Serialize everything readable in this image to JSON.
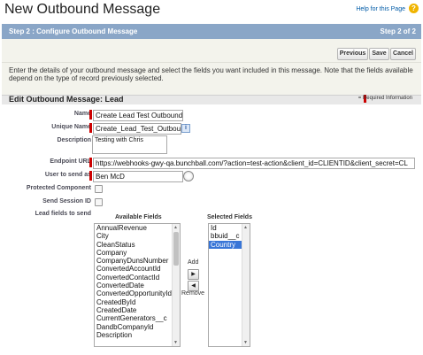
{
  "page_title": "New Outbound Message",
  "help_link": "Help for this Page",
  "help_icon": "?",
  "step": {
    "title": "Step 2 : Configure Outbound Message",
    "count": "Step 2 of 2"
  },
  "buttons": {
    "previous": "Previous",
    "save": "Save",
    "cancel": "Cancel"
  },
  "description": "Enter the details of your outbound message and select the fields you want included in this message. Note that the fields available depend on the type of record previously selected.",
  "section": {
    "title": "Edit Outbound Message: Lead",
    "required_info": "= Required Information"
  },
  "form": {
    "name_label": "Name",
    "name_value": "Create Lead Test Outbound",
    "unique_name_label": "Unique Name",
    "unique_name_value": "Create_Lead_Test_Outboun",
    "description_label": "Description",
    "description_value": "Testing with Chris",
    "endpoint_label": "Endpoint URL",
    "endpoint_value": "https://webhooks-gwy-qa.bunchball.com/?action=test-action&client_id=CLIENTID&client_secret=CL",
    "user_label": "User to send as",
    "user_value": "Ben McD",
    "protected_label": "Protected Component",
    "session_label": "Send Session ID",
    "lead_fields_label": "Lead fields to send"
  },
  "fields": {
    "available_heading": "Available Fields",
    "selected_heading": "Selected Fields",
    "available": [
      "AnnualRevenue",
      "City",
      "CleanStatus",
      "Company",
      "CompanyDunsNumber",
      "ConvertedAccountId",
      "ConvertedContactId",
      "ConvertedDate",
      "ConvertedOpportunityId",
      "CreatedById",
      "CreatedDate",
      "CurrentGenerators__c",
      "DandbCompanyId",
      "Description"
    ],
    "selected": [
      "Id",
      "bbuid__c",
      "Country"
    ],
    "selected_highlight": "Country",
    "add_label": "Add",
    "remove_label": "Remove"
  },
  "colors": {
    "step_bar": "#8aa6c7",
    "required": "#cc0000",
    "selection": "#3875d7"
  }
}
